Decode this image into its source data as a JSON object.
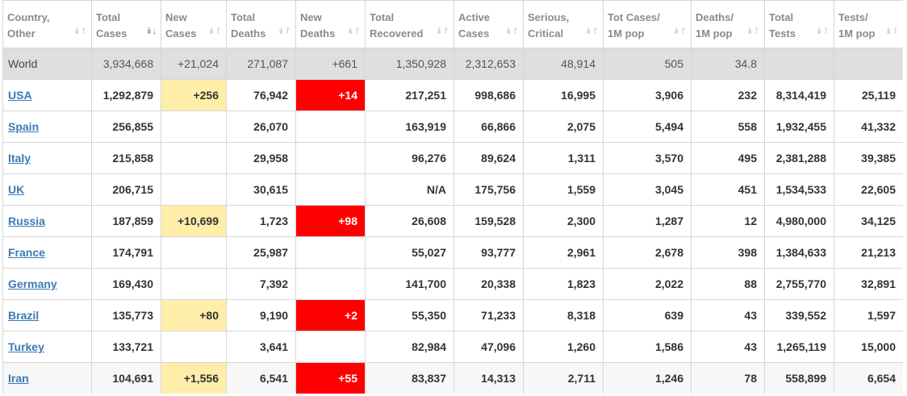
{
  "colors": {
    "new_cases_highlight": "#ffeeaa",
    "new_deaths_highlight": "#ff0000",
    "world_row_bg": "#dfdfdf",
    "link": "#3b7ab8",
    "header_text": "#8b8b8b"
  },
  "icons": {
    "sort_default": "sort-arrows-icon",
    "sort_active": "sort-descending-icon"
  },
  "columns": [
    {
      "line1": "Country,",
      "line2": "Other",
      "sort": "↡↾"
    },
    {
      "line1": "Total",
      "line2": "Cases",
      "sort": "↡↓",
      "active": true
    },
    {
      "line1": "New",
      "line2": "Cases",
      "sort": "↡↾"
    },
    {
      "line1": "Total",
      "line2": "Deaths",
      "sort": "↡↾"
    },
    {
      "line1": "New",
      "line2": "Deaths",
      "sort": "↡↾"
    },
    {
      "line1": "Total",
      "line2": "Recovered",
      "sort": "↡↾"
    },
    {
      "line1": "Active",
      "line2": "Cases",
      "sort": "↡↾"
    },
    {
      "line1": "Serious,",
      "line2": "Critical",
      "sort": "↡↾"
    },
    {
      "line1": "Tot Cases/",
      "line2": "1M pop",
      "sort": "↡↾"
    },
    {
      "line1": "Deaths/",
      "line2": "1M pop",
      "sort": "↡↾"
    },
    {
      "line1": "Total",
      "line2": "Tests",
      "sort": "↡↾"
    },
    {
      "line1": "Tests/",
      "line2": "1M pop",
      "sort": "↡↾"
    }
  ],
  "rows": [
    {
      "country": "World",
      "total_cases": "3,934,668",
      "new_cases": "+21,024",
      "total_deaths": "271,087",
      "new_deaths": "+661",
      "total_recovered": "1,350,928",
      "active_cases": "2,312,653",
      "serious_critical": "48,914",
      "tot_cases_1m": "505",
      "deaths_1m": "34.8",
      "total_tests": "",
      "tests_1m": ""
    },
    {
      "country": "USA",
      "total_cases": "1,292,879",
      "new_cases": "+256",
      "total_deaths": "76,942",
      "new_deaths": "+14",
      "total_recovered": "217,251",
      "active_cases": "998,686",
      "serious_critical": "16,995",
      "tot_cases_1m": "3,906",
      "deaths_1m": "232",
      "total_tests": "8,314,419",
      "tests_1m": "25,119"
    },
    {
      "country": "Spain",
      "total_cases": "256,855",
      "new_cases": "",
      "total_deaths": "26,070",
      "new_deaths": "",
      "total_recovered": "163,919",
      "active_cases": "66,866",
      "serious_critical": "2,075",
      "tot_cases_1m": "5,494",
      "deaths_1m": "558",
      "total_tests": "1,932,455",
      "tests_1m": "41,332"
    },
    {
      "country": "Italy",
      "total_cases": "215,858",
      "new_cases": "",
      "total_deaths": "29,958",
      "new_deaths": "",
      "total_recovered": "96,276",
      "active_cases": "89,624",
      "serious_critical": "1,311",
      "tot_cases_1m": "3,570",
      "deaths_1m": "495",
      "total_tests": "2,381,288",
      "tests_1m": "39,385"
    },
    {
      "country": "UK",
      "total_cases": "206,715",
      "new_cases": "",
      "total_deaths": "30,615",
      "new_deaths": "",
      "total_recovered": "N/A",
      "active_cases": "175,756",
      "serious_critical": "1,559",
      "tot_cases_1m": "3,045",
      "deaths_1m": "451",
      "total_tests": "1,534,533",
      "tests_1m": "22,605"
    },
    {
      "country": "Russia",
      "total_cases": "187,859",
      "new_cases": "+10,699",
      "total_deaths": "1,723",
      "new_deaths": "+98",
      "total_recovered": "26,608",
      "active_cases": "159,528",
      "serious_critical": "2,300",
      "tot_cases_1m": "1,287",
      "deaths_1m": "12",
      "total_tests": "4,980,000",
      "tests_1m": "34,125"
    },
    {
      "country": "France",
      "total_cases": "174,791",
      "new_cases": "",
      "total_deaths": "25,987",
      "new_deaths": "",
      "total_recovered": "55,027",
      "active_cases": "93,777",
      "serious_critical": "2,961",
      "tot_cases_1m": "2,678",
      "deaths_1m": "398",
      "total_tests": "1,384,633",
      "tests_1m": "21,213"
    },
    {
      "country": "Germany",
      "total_cases": "169,430",
      "new_cases": "",
      "total_deaths": "7,392",
      "new_deaths": "",
      "total_recovered": "141,700",
      "active_cases": "20,338",
      "serious_critical": "1,823",
      "tot_cases_1m": "2,022",
      "deaths_1m": "88",
      "total_tests": "2,755,770",
      "tests_1m": "32,891"
    },
    {
      "country": "Brazil",
      "total_cases": "135,773",
      "new_cases": "+80",
      "total_deaths": "9,190",
      "new_deaths": "+2",
      "total_recovered": "55,350",
      "active_cases": "71,233",
      "serious_critical": "8,318",
      "tot_cases_1m": "639",
      "deaths_1m": "43",
      "total_tests": "339,552",
      "tests_1m": "1,597"
    },
    {
      "country": "Turkey",
      "total_cases": "133,721",
      "new_cases": "",
      "total_deaths": "3,641",
      "new_deaths": "",
      "total_recovered": "82,984",
      "active_cases": "47,096",
      "serious_critical": "1,260",
      "tot_cases_1m": "1,586",
      "deaths_1m": "43",
      "total_tests": "1,265,119",
      "tests_1m": "15,000"
    },
    {
      "country": "Iran",
      "total_cases": "104,691",
      "new_cases": "+1,556",
      "total_deaths": "6,541",
      "new_deaths": "+55",
      "total_recovered": "83,837",
      "active_cases": "14,313",
      "serious_critical": "2,711",
      "tot_cases_1m": "1,246",
      "deaths_1m": "78",
      "total_tests": "558,899",
      "tests_1m": "6,654"
    }
  ]
}
